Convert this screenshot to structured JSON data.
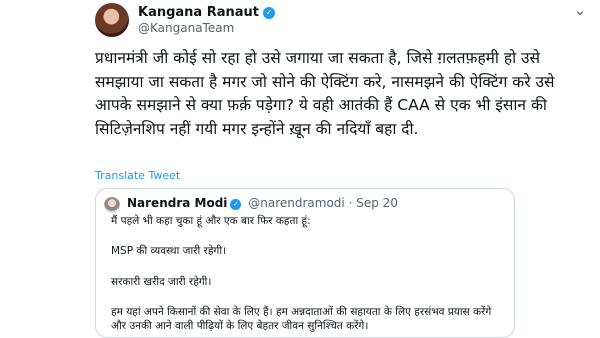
{
  "author": {
    "name": "Kangana Ranaut",
    "handle": "@KanganaTeam"
  },
  "tweet": {
    "text": "प्रधानमंत्री जी कोई सो रहा हो उसे जगाया जा सकता है, जिसे ग़लतफ़हमी हो उसे समझाया जा सकता है मगर जो सोने की ऐक्टिंग करे, नासमझने की ऐक्टिंग करे उसे आपके समझाने से क्या फ़र्क़ पड़ेगा? ये वही आतंकी हैं CAA से एक भी इंसान की सिटिज़ेनशिप नहीं गयी मगर इन्होंने ख़ून की नदियाँ बहा दी.",
    "translate_label": "Translate Tweet"
  },
  "quote": {
    "name": "Narendra Modi",
    "handle": "@narendramodi",
    "separator": "·",
    "date": "Sep 20",
    "paragraphs": [
      "मैं पहले भी कहा चुका हूं और एक बार फिर कहता हूं:",
      "MSP की व्यवस्था जारी रहेगी।",
      "सरकारी खरीद जारी रहेगी।",
      "हम यहां अपने किसानों की सेवा के लिए हैं। हम अन्नदाताओं की सहायता के लिए हरसंभव प्रयास करेंगे और उनकी आने वाली पीढ़ियों के लिए बेहतर जीवन सुनिश्चित करेंगे।"
    ]
  },
  "icons": {
    "verified": "✓",
    "more": "⌄"
  },
  "colors": {
    "accent": "#1d9bf0",
    "secondary_text": "#536471",
    "border": "#cfd9de"
  }
}
